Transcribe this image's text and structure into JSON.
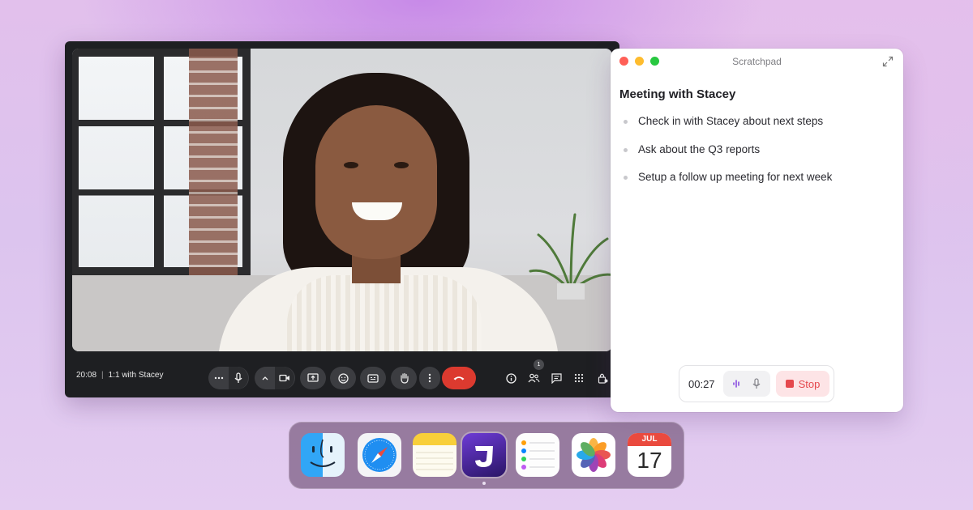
{
  "meeting": {
    "time": "20:08",
    "separator": "|",
    "name": "1:1 with Stacey",
    "participants_badge": "1",
    "colors": {
      "end_call": "#dc3a2f",
      "toolbar_bg": "#1e1f22"
    }
  },
  "scratchpad": {
    "window_title": "Scratchpad",
    "note_title": "Meeting with Stacey",
    "items": [
      {
        "text": "Check in with Stacey about next steps"
      },
      {
        "text": "Ask about the Q3 reports"
      },
      {
        "text": "Setup a follow up meeting for next week"
      }
    ],
    "recorder": {
      "elapsed": "00:27",
      "stop_label": "Stop",
      "accent": "#8a4ee0",
      "stop_color": "#e5484d"
    }
  },
  "dock": {
    "apps": [
      {
        "name": "finder-icon"
      },
      {
        "name": "safari-icon"
      },
      {
        "name": "notes-icon"
      },
      {
        "name": "jamie-app-icon",
        "running": true
      },
      {
        "name": "reminders-icon"
      },
      {
        "name": "photos-icon"
      },
      {
        "name": "calendar-icon"
      }
    ],
    "calendar": {
      "month": "JUL",
      "day": "17"
    }
  }
}
